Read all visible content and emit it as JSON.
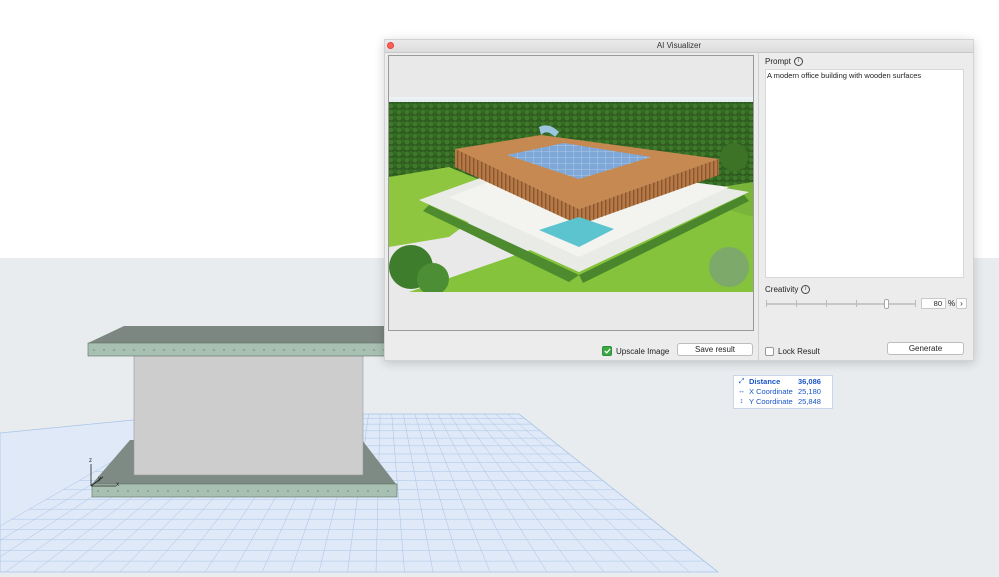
{
  "dialog": {
    "title": "AI Visualizer",
    "prompt_label": "Prompt",
    "prompt_text": "A modern office building with wooden surfaces",
    "creativity_label": "Creativity",
    "creativity_value": "80",
    "creativity_percent": 80,
    "percent_unit": "%",
    "upscale_label": "Upscale Image",
    "upscale_checked": true,
    "save_label": "Save result",
    "lock_label": "Lock Result",
    "lock_checked": false,
    "generate_label": "Generate",
    "info_glyph": "i",
    "stepper_glyph": "›"
  },
  "readout": {
    "rows": [
      {
        "icon": "distance-icon",
        "label": "Distance",
        "value": "36,086"
      },
      {
        "icon": "x-arrow-icon",
        "label": "X Coordinate",
        "value": "25,180"
      },
      {
        "icon": "y-arrow-icon",
        "label": "Y Coordinate",
        "value": "25,848"
      }
    ]
  },
  "axes": {
    "z": "z",
    "y": "y",
    "x": "x"
  },
  "colors": {
    "accent_check": "#3aa845",
    "readout_text": "#1a55c8",
    "close_button": "#fe5f57",
    "grid_line": "#a8c4e8"
  }
}
